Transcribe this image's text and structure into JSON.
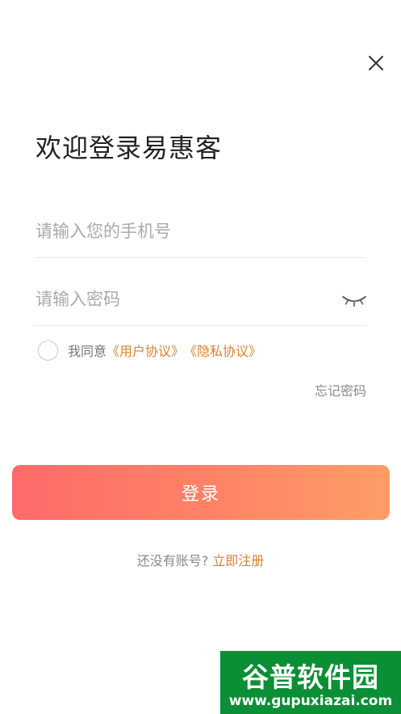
{
  "header": {
    "close_icon": "close-icon",
    "title": "欢迎登录易惠客"
  },
  "form": {
    "phone_placeholder": "请输入您的手机号",
    "phone_value": "",
    "password_placeholder": "请输入密码",
    "password_value": "",
    "password_toggle_icon": "eye-closed-icon",
    "agree_checked": false,
    "agree_prefix": "我同意",
    "user_agreement_link": "《用户协议》",
    "privacy_link": "《隐私协议》",
    "forgot_password": "忘记密码"
  },
  "actions": {
    "login_label": "登录",
    "register_prompt": "还没有账号?",
    "register_link": "立即注册"
  },
  "colors": {
    "accent": "#d8822e",
    "button_gradient_start": "#fe6a6a",
    "button_gradient_end": "#ff9d66"
  },
  "watermark": {
    "logo_text": "谷普软件园",
    "url": "www.gupuxiazai.com"
  }
}
